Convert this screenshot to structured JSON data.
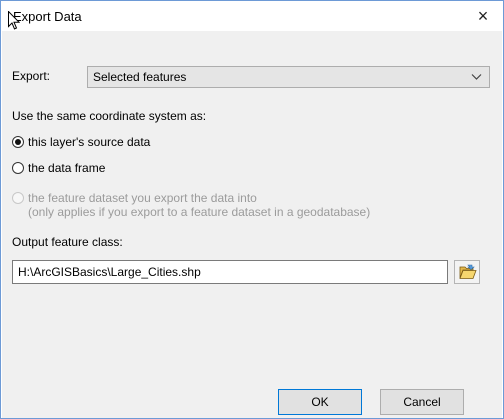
{
  "window": {
    "title": "Export Data",
    "close_glyph": "×"
  },
  "export": {
    "label": "Export:",
    "selected": "Selected features"
  },
  "coordinate": {
    "heading": "Use the same coordinate system as:",
    "options": [
      {
        "label": "this layer's source data",
        "checked": true,
        "enabled": true
      },
      {
        "label": "the data frame",
        "checked": false,
        "enabled": true
      },
      {
        "label": "the feature dataset you export the data into",
        "sublabel": "(only applies if you export to a feature dataset in a geodatabase)",
        "checked": false,
        "enabled": false
      }
    ]
  },
  "output": {
    "label": "Output feature class:",
    "value": "H:\\ArcGISBasics\\Large_Cities.shp"
  },
  "buttons": {
    "ok": "OK",
    "cancel": "Cancel"
  },
  "icons": {
    "browse": "folder-open-icon",
    "dropdown": "chevron-down-icon",
    "close": "close-icon",
    "cursor": "mouse-cursor-icon"
  }
}
